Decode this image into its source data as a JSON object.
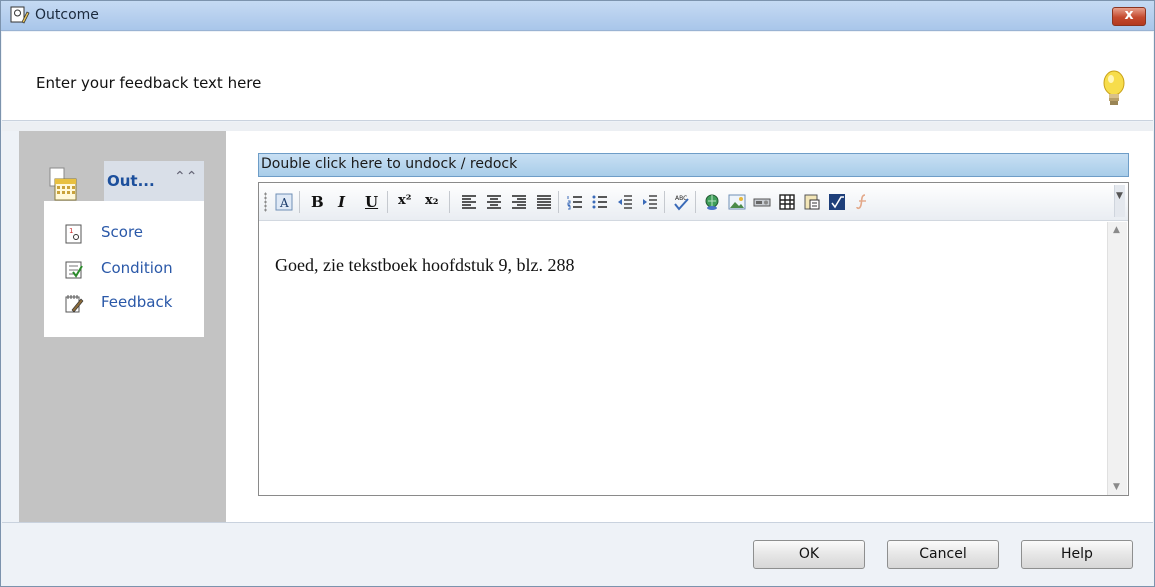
{
  "window": {
    "title": "Outcome",
    "close_label": "x"
  },
  "header": {
    "instruction": "Enter your feedback text here",
    "hint_icon": "lightbulb-icon"
  },
  "sidebar": {
    "group_label": "Out...",
    "items": [
      {
        "label": "Score",
        "icon": "score-icon"
      },
      {
        "label": "Condition",
        "icon": "condition-icon"
      },
      {
        "label": "Feedback",
        "icon": "feedback-icon"
      }
    ]
  },
  "editor": {
    "dock_label": "Double click here to undock / redock",
    "content": "Goed, zie tekstboek hoofdstuk 9, blz. 288",
    "toolbar": {
      "bold": "B",
      "italic": "I",
      "underline": "U",
      "superscript": "x²",
      "subscript": "x₂"
    }
  },
  "footer": {
    "ok_label": "OK",
    "cancel_label": "Cancel",
    "help_label": "Help"
  },
  "colors": {
    "titlebar": "#a9c6ea",
    "link": "#2a58a8",
    "sidebar_bg": "#c3c3c3",
    "dockbar": "#a8cde9"
  }
}
